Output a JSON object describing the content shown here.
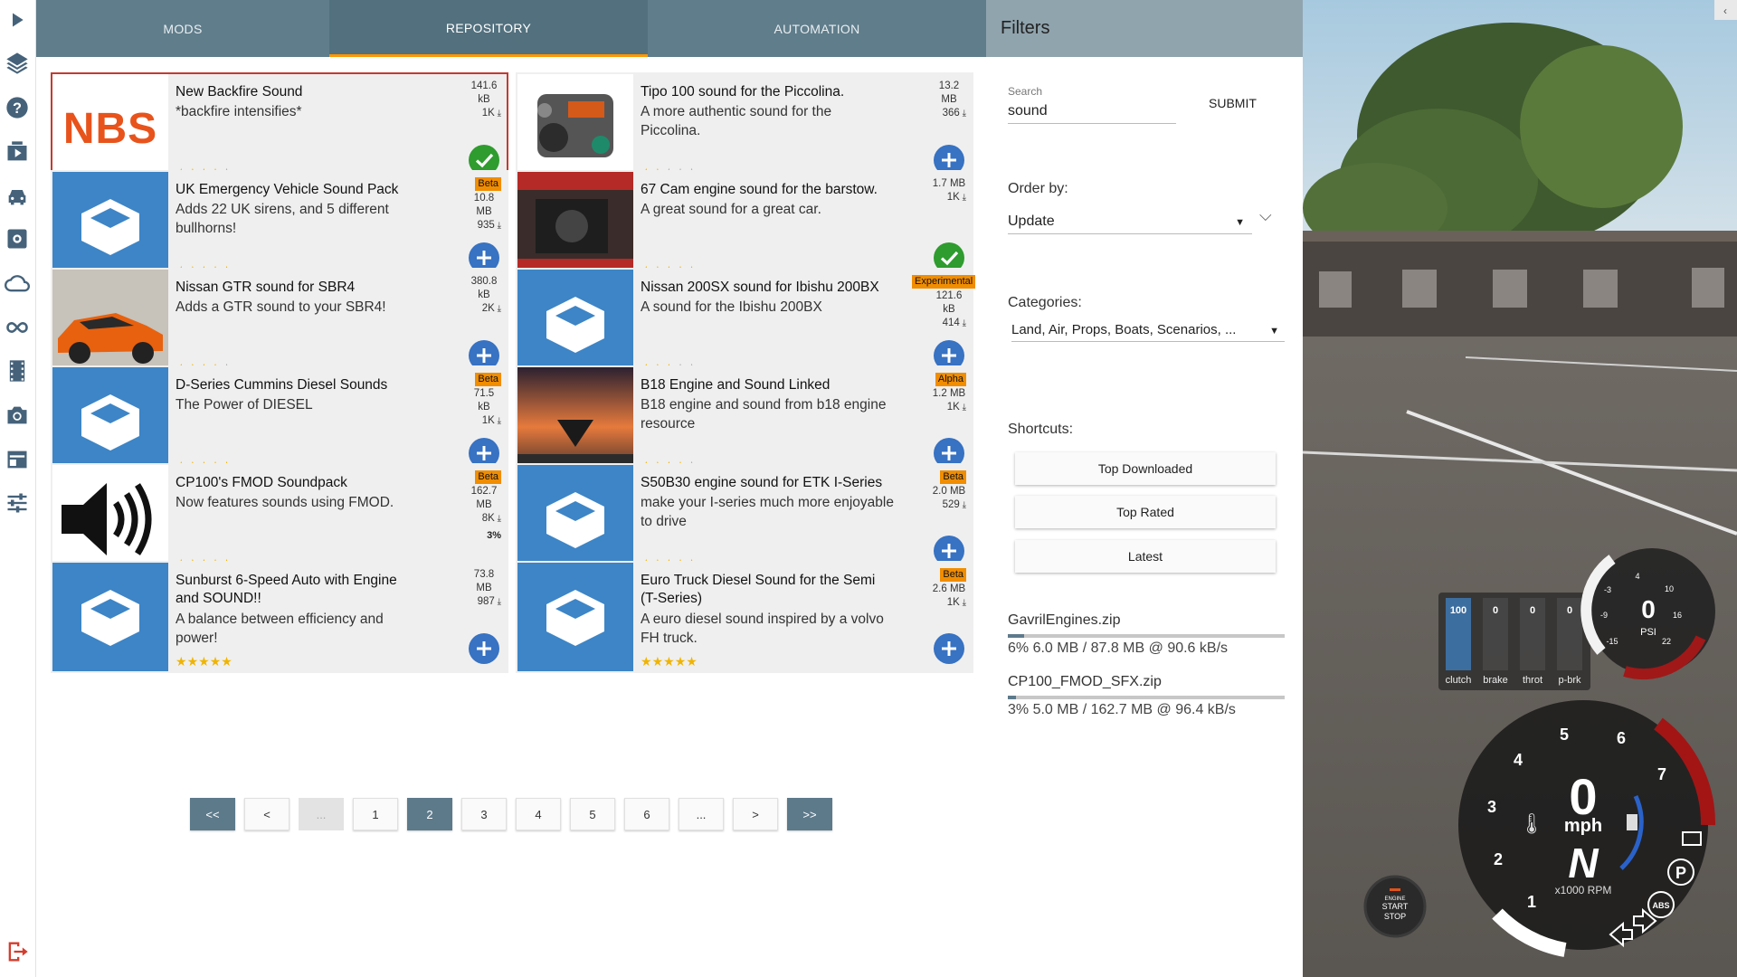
{
  "sidebar": {
    "items": [
      "play-icon",
      "layers-icon",
      "help-icon",
      "video-icon",
      "car-icon",
      "settings-icon",
      "cloud-icon",
      "infinity-icon",
      "film-icon",
      "camera-icon",
      "dashboard-icon",
      "sliders-icon"
    ],
    "exit": "exit-icon"
  },
  "tabs": [
    {
      "label": "MODS",
      "active": false
    },
    {
      "label": "REPOSITORY",
      "active": true
    },
    {
      "label": "AUTOMATION",
      "active": false
    }
  ],
  "mods": [
    {
      "title": "New Backfire Sound",
      "desc": "*backfire intensifies*",
      "size": "141.6 kB",
      "downloads": "1K",
      "rating": 4,
      "badge": "",
      "status": "installed",
      "thumb": "nbs",
      "thumb_text": "NBS",
      "selected": true
    },
    {
      "title": "Tipo 100 sound for the Piccolina.",
      "desc": "A more authentic sound for the Piccolina.",
      "size": "13.2 MB",
      "downloads": "366",
      "rating": 2,
      "badge": "",
      "status": "add",
      "thumb": "engine"
    },
    {
      "title": "UK Emergency Vehicle Sound Pack",
      "desc": "Adds 22 UK sirens, and 5 different bullhorns!",
      "size": "10.8 MB",
      "downloads": "935",
      "rating": 5,
      "badge": "Beta",
      "status": "add",
      "thumb": "box"
    },
    {
      "title": "67 Cam engine sound for the barstow.",
      "desc": "A great sound for a great car.",
      "size": "1.7 MB",
      "downloads": "1K",
      "rating": 5,
      "badge": "",
      "status": "installed",
      "thumb": "bay"
    },
    {
      "title": "Nissan GTR sound for SBR4",
      "desc": "Adds a GTR sound to your SBR4!",
      "size": "380.8 kB",
      "downloads": "2K",
      "rating": 4,
      "badge": "",
      "status": "add",
      "thumb": "car"
    },
    {
      "title": "Nissan 200SX sound for Ibishu 200BX",
      "desc": "A sound for the Ibishu 200BX",
      "size": "121.6 kB",
      "downloads": "414",
      "rating": 3,
      "badge": "Experimental",
      "status": "add",
      "thumb": "box"
    },
    {
      "title": "D-Series Cummins Diesel Sounds",
      "desc": "The Power of DIESEL",
      "size": "71.5 kB",
      "downloads": "1K",
      "rating": 5,
      "badge": "Beta",
      "status": "add",
      "thumb": "box"
    },
    {
      "title": "B18 Engine and Sound Linked",
      "desc": "B18 engine and sound from b18 engine resource",
      "size": "1.2 MB",
      "downloads": "1K",
      "rating": 4,
      "badge": "Alpha",
      "status": "add",
      "thumb": "sunset"
    },
    {
      "title": "CP100's FMOD Soundpack",
      "desc": "Now features sounds using FMOD.",
      "size": "162.7 MB",
      "downloads": "8K",
      "rating": 5,
      "badge": "Beta",
      "status": "progress",
      "progress": "3%",
      "thumb": "speaker"
    },
    {
      "title": "S50B30 engine sound for ETK I-Series",
      "desc": "make your I-series much more enjoyable to drive",
      "size": "2.0 MB",
      "downloads": "529",
      "rating": 5,
      "badge": "Beta",
      "status": "add",
      "thumb": "box"
    },
    {
      "title": "Sunburst 6-Speed Auto with Engine and SOUND!!",
      "desc": "A balance between efficiency and power!",
      "size": "73.8 MB",
      "downloads": "987",
      "rating": 5,
      "badge": "",
      "status": "add",
      "thumb": "box"
    },
    {
      "title": "Euro Truck Diesel Sound for the Semi (T-Series)",
      "desc": "A euro diesel sound inspired by a volvo FH truck.",
      "size": "2.6 MB",
      "downloads": "1K",
      "rating": 5,
      "badge": "Beta",
      "status": "add",
      "thumb": "box"
    }
  ],
  "pager": [
    {
      "label": "<<",
      "style": "dark"
    },
    {
      "label": "<",
      "style": "normal"
    },
    {
      "label": "...",
      "style": "dim"
    },
    {
      "label": "1",
      "style": "normal"
    },
    {
      "label": "2",
      "style": "dark"
    },
    {
      "label": "3",
      "style": "normal"
    },
    {
      "label": "4",
      "style": "normal"
    },
    {
      "label": "5",
      "style": "normal"
    },
    {
      "label": "6",
      "style": "normal"
    },
    {
      "label": "...",
      "style": "normal"
    },
    {
      "label": ">",
      "style": "normal"
    },
    {
      "label": ">>",
      "style": "dark"
    }
  ],
  "filters": {
    "title": "Filters",
    "search_label": "Search",
    "search_value": "sound",
    "submit": "SUBMIT",
    "order_label": "Order by:",
    "order_value": "Update",
    "categories_label": "Categories:",
    "categories_value": "Land, Air, Props, Boats, Scenarios, ...",
    "shortcuts_label": "Shortcuts:",
    "shortcuts": [
      "Top Downloaded",
      "Top Rated",
      "Latest"
    ],
    "downloads": [
      {
        "name": "GavrilEngines.zip",
        "status": "6% 6.0 MB / 87.8 MB @ 90.6 kB/s",
        "fraction": 0.06
      },
      {
        "name": "CP100_FMOD_SFX.zip",
        "status": "3% 5.0 MB / 162.7 MB @ 96.4 kB/s",
        "fraction": 0.03
      }
    ]
  },
  "hud": {
    "pedals": [
      {
        "label": "clutch",
        "value": "100"
      },
      {
        "label": "brake",
        "value": "0"
      },
      {
        "label": "throt",
        "value": "0"
      },
      {
        "label": "p-brk",
        "value": "0"
      }
    ],
    "boost_value": "0",
    "boost_unit": "PSI",
    "boost_ticks": [
      "-3",
      "-9",
      "-15",
      "4",
      "10",
      "16",
      "22"
    ],
    "speed": "0",
    "speed_unit": "mph",
    "gear": "N",
    "rpm_unit": "x1000 RPM",
    "rpm_ticks": [
      "1",
      "2",
      "3",
      "4",
      "5",
      "6",
      "7"
    ],
    "start_top": "ENGINE",
    "start_mid": "START",
    "start_bot": "STOP",
    "abs": "ABS",
    "park": "P"
  },
  "colors": {
    "accent": "#607d8b",
    "tab_active": "#52707e",
    "underline": "#ff9800",
    "add": "#3772c3",
    "installed": "#2e9c2e",
    "badge": "#f18d00",
    "selected_border": "#c23b32"
  }
}
